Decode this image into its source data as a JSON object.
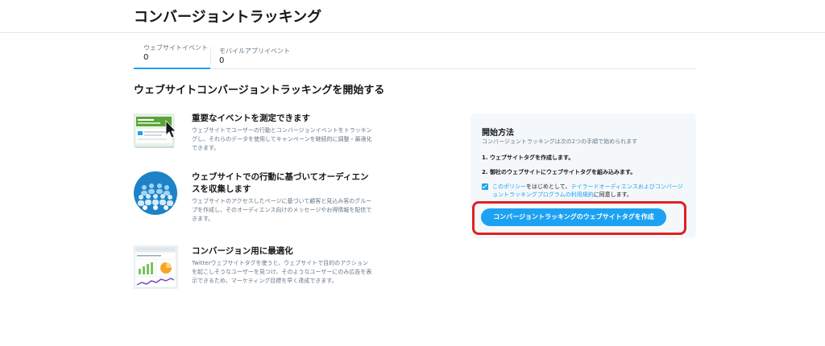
{
  "header": {
    "title": "コンバージョントラッキング"
  },
  "tabs": [
    {
      "label": "ウェブサイトイベント",
      "count": "0"
    },
    {
      "label": "モバイルアプリイベント",
      "count": "0"
    }
  ],
  "section": {
    "title": "ウェブサイトコンバージョントラッキングを開始する"
  },
  "features": [
    {
      "icon": "event-measure-illustration-icon",
      "heading": "重要なイベントを測定できます",
      "desc": "ウェブサイトでユーザーの行動とコンバージョンイベントをトラッキングし、それらのデータを使用してキャンペーンを継続的に調整・最適化できます。"
    },
    {
      "icon": "audience-group-illustration-icon",
      "heading": "ウェブサイトでの行動に基づいてオーディエンスを収集します",
      "desc": "ウェブサイトのアクセスしたページに基づいて顧客と見込み客のグループを作成し、そのオーディエンス向けのメッセージやお得情報を配信できます。"
    },
    {
      "icon": "conversion-chart-illustration-icon",
      "heading": "コンバージョン用に最適化",
      "desc": "Twitterウェブサイトタグを使うと、ウェブサイトで目的のアクションを起こしそうなユーザーを見つけ、そのようなユーザーにのみ広告を表示できるため、マーケティング目標を早く達成できます。"
    }
  ],
  "start": {
    "title": "開始方法",
    "subtitle": "コンバージョントラッキングは次の2つの手順で始められます",
    "step1": "1. ウェブサイトタグを作成します。",
    "step2": "2. 御社のウェブサイトにウェブサイトタグを組み込みます。",
    "agree_link1": "このポリシー",
    "agree_mid": "をはじめとして、",
    "agree_link2": "テイラードオーディエンスおよびコンバージョントラッキングプログラムの利用規約",
    "agree_end": "に同意します。",
    "checkbox_checked": true,
    "button_label": "コンバージョントラッキングのウェブサイトタグを作成"
  },
  "colors": {
    "accent": "#1da1f2",
    "highlight": "#e02020",
    "panel": "#f5f8fa"
  }
}
